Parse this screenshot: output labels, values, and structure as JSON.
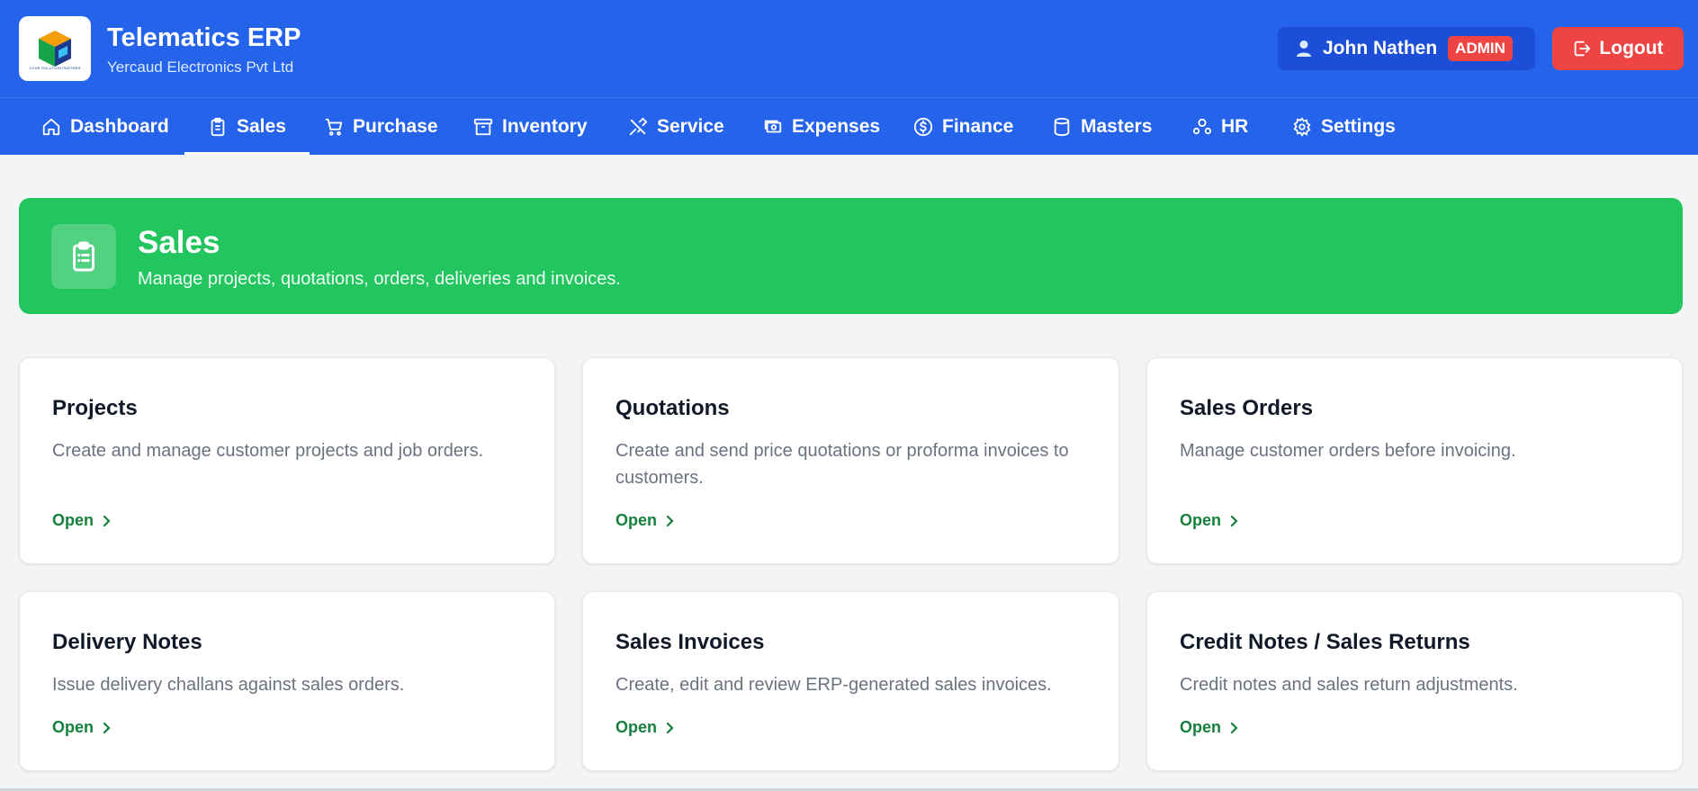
{
  "app": {
    "title": "Telematics ERP",
    "subtitle": "Yercaud Electronics Pvt Ltd",
    "logo_tag": "YOUR SOLUTION PARTNER"
  },
  "user": {
    "name": "John Nathen",
    "role": "ADMIN"
  },
  "logout_label": "Logout",
  "nav": {
    "active": "Sales",
    "items": [
      {
        "label": "Dashboard",
        "icon": "home-icon"
      },
      {
        "label": "Sales",
        "icon": "clipboard-icon"
      },
      {
        "label": "Purchase",
        "icon": "cart-icon"
      },
      {
        "label": "Inventory",
        "icon": "archive-icon"
      },
      {
        "label": "Service",
        "icon": "tools-icon"
      },
      {
        "label": "Expenses",
        "icon": "banknotes-icon"
      },
      {
        "label": "Finance",
        "icon": "dollar-circle-icon"
      },
      {
        "label": "Masters",
        "icon": "database-icon"
      },
      {
        "label": "HR",
        "icon": "users-icon"
      },
      {
        "label": "Settings",
        "icon": "gear-icon"
      }
    ]
  },
  "hero": {
    "title": "Sales",
    "subtitle": "Manage projects, quotations, orders, deliveries and invoices.",
    "icon": "clipboard-list-icon"
  },
  "cards": [
    {
      "title": "Projects",
      "description": "Create and manage customer projects and job orders.",
      "link": "Open"
    },
    {
      "title": "Quotations",
      "description": "Create and send price quotations or proforma invoices to customers.",
      "link": "Open"
    },
    {
      "title": "Sales Orders",
      "description": "Manage customer orders before invoicing.",
      "link": "Open"
    },
    {
      "title": "Delivery Notes",
      "description": "Issue delivery challans against sales orders.",
      "link": "Open"
    },
    {
      "title": "Sales Invoices",
      "description": "Create, edit and review ERP-generated sales invoices.",
      "link": "Open"
    },
    {
      "title": "Credit Notes / Sales Returns",
      "description": "Credit notes and sales return adjustments.",
      "link": "Open"
    }
  ],
  "colors": {
    "primary": "#2563eb",
    "hero": "#22c55e",
    "danger": "#ef4444",
    "link": "#15803d"
  }
}
